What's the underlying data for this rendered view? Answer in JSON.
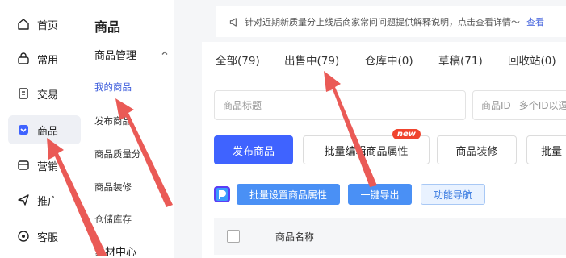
{
  "left_nav": {
    "items": [
      {
        "label": "首页",
        "icon": "home-icon"
      },
      {
        "label": "常用",
        "icon": "bag-icon"
      },
      {
        "label": "交易",
        "icon": "document-icon"
      },
      {
        "label": "商品",
        "icon": "product-icon",
        "active": true
      },
      {
        "label": "营销",
        "icon": "megaphone-icon"
      },
      {
        "label": "推广",
        "icon": "send-icon"
      },
      {
        "label": "客服",
        "icon": "headset-icon"
      }
    ]
  },
  "sub_menu": {
    "title": "商品",
    "group_label": "商品管理",
    "items": [
      "我的商品",
      "发布商品",
      "商品质量分",
      "商品装修",
      "仓储库存"
    ],
    "active_item": "我的商品",
    "bottom_label": "素材中心"
  },
  "notice": {
    "text": "针对近期新质量分上线后商家常问问题提供解释说明，点击查看详情～",
    "link": "查看"
  },
  "tabs": [
    "全部(79)",
    "出售中(79)",
    "仓库中(0)",
    "草稿(71)",
    "回收站(0)"
  ],
  "search": {
    "title_placeholder": "商品标题",
    "id_label": "商品ID",
    "id_placeholder": "多个ID以逗"
  },
  "actions": {
    "publish": "发布商品",
    "bulk_edit": "批量编辑商品属性",
    "new_badge": "new",
    "decorate": "商品装修",
    "more": "批量"
  },
  "tools": {
    "bulk_set": "批量设置商品属性",
    "export": "一键导出",
    "guide": "功能导航"
  },
  "table": {
    "col_name": "商品名称"
  },
  "colors": {
    "primary": "#3f63ff",
    "accent_blue": "#4a90f5",
    "arrow": "#ea5a56",
    "badge": "#f0442e"
  }
}
